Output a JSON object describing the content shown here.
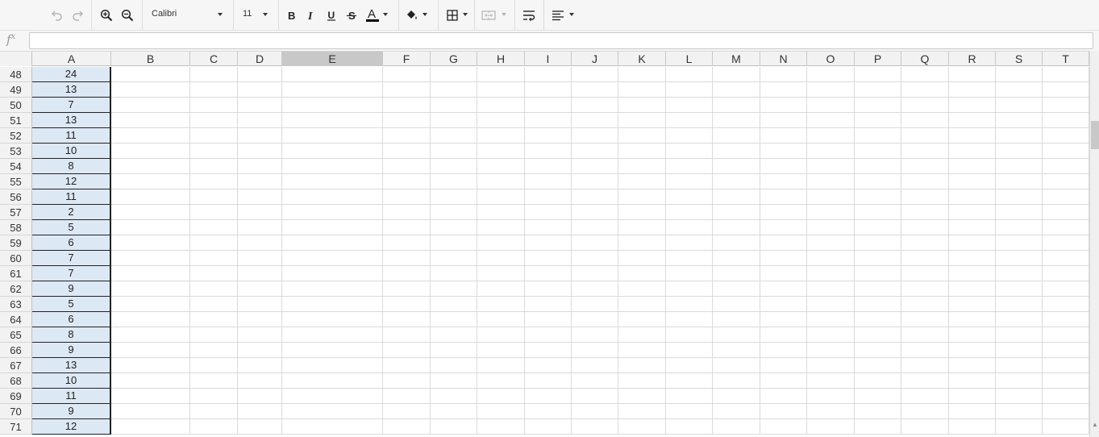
{
  "toolbar": {
    "font_family": "Calibri",
    "font_size": "11",
    "icons": [
      "undo-icon",
      "redo-icon",
      "zoom-in-icon",
      "zoom-out-icon",
      "bold-icon",
      "italic-icon",
      "underline-icon",
      "strikethrough-icon",
      "font-color-icon",
      "fill-color-icon",
      "borders-icon",
      "merge-cells-icon",
      "wrap-text-icon",
      "align-icon"
    ],
    "font_color": "#000000"
  },
  "formula_bar": {
    "label": "f",
    "label_sup": "x",
    "value": ""
  },
  "columns": [
    "A",
    "B",
    "C",
    "D",
    "E",
    "F",
    "G",
    "H",
    "I",
    "J",
    "K",
    "L",
    "M",
    "N",
    "O",
    "P",
    "Q",
    "R",
    "S",
    "T"
  ],
  "active_column": "E",
  "rows": [
    {
      "num": "48",
      "a": "24"
    },
    {
      "num": "49",
      "a": "13"
    },
    {
      "num": "50",
      "a": "7"
    },
    {
      "num": "51",
      "a": "13"
    },
    {
      "num": "52",
      "a": "11"
    },
    {
      "num": "53",
      "a": "10"
    },
    {
      "num": "54",
      "a": "8"
    },
    {
      "num": "55",
      "a": "12"
    },
    {
      "num": "56",
      "a": "11"
    },
    {
      "num": "57",
      "a": "2"
    },
    {
      "num": "58",
      "a": "5"
    },
    {
      "num": "59",
      "a": "6"
    },
    {
      "num": "60",
      "a": "7"
    },
    {
      "num": "61",
      "a": "7"
    },
    {
      "num": "62",
      "a": "9"
    },
    {
      "num": "63",
      "a": "5"
    },
    {
      "num": "64",
      "a": "6"
    },
    {
      "num": "65",
      "a": "8"
    },
    {
      "num": "66",
      "a": "9"
    },
    {
      "num": "67",
      "a": "13"
    },
    {
      "num": "68",
      "a": "10"
    },
    {
      "num": "69",
      "a": "11"
    },
    {
      "num": "70",
      "a": "9"
    },
    {
      "num": "71",
      "a": "12"
    }
  ],
  "colors": {
    "selection_fill": "#dde8f5",
    "active_header": "#c8c8c8",
    "gridline": "#dadada"
  }
}
